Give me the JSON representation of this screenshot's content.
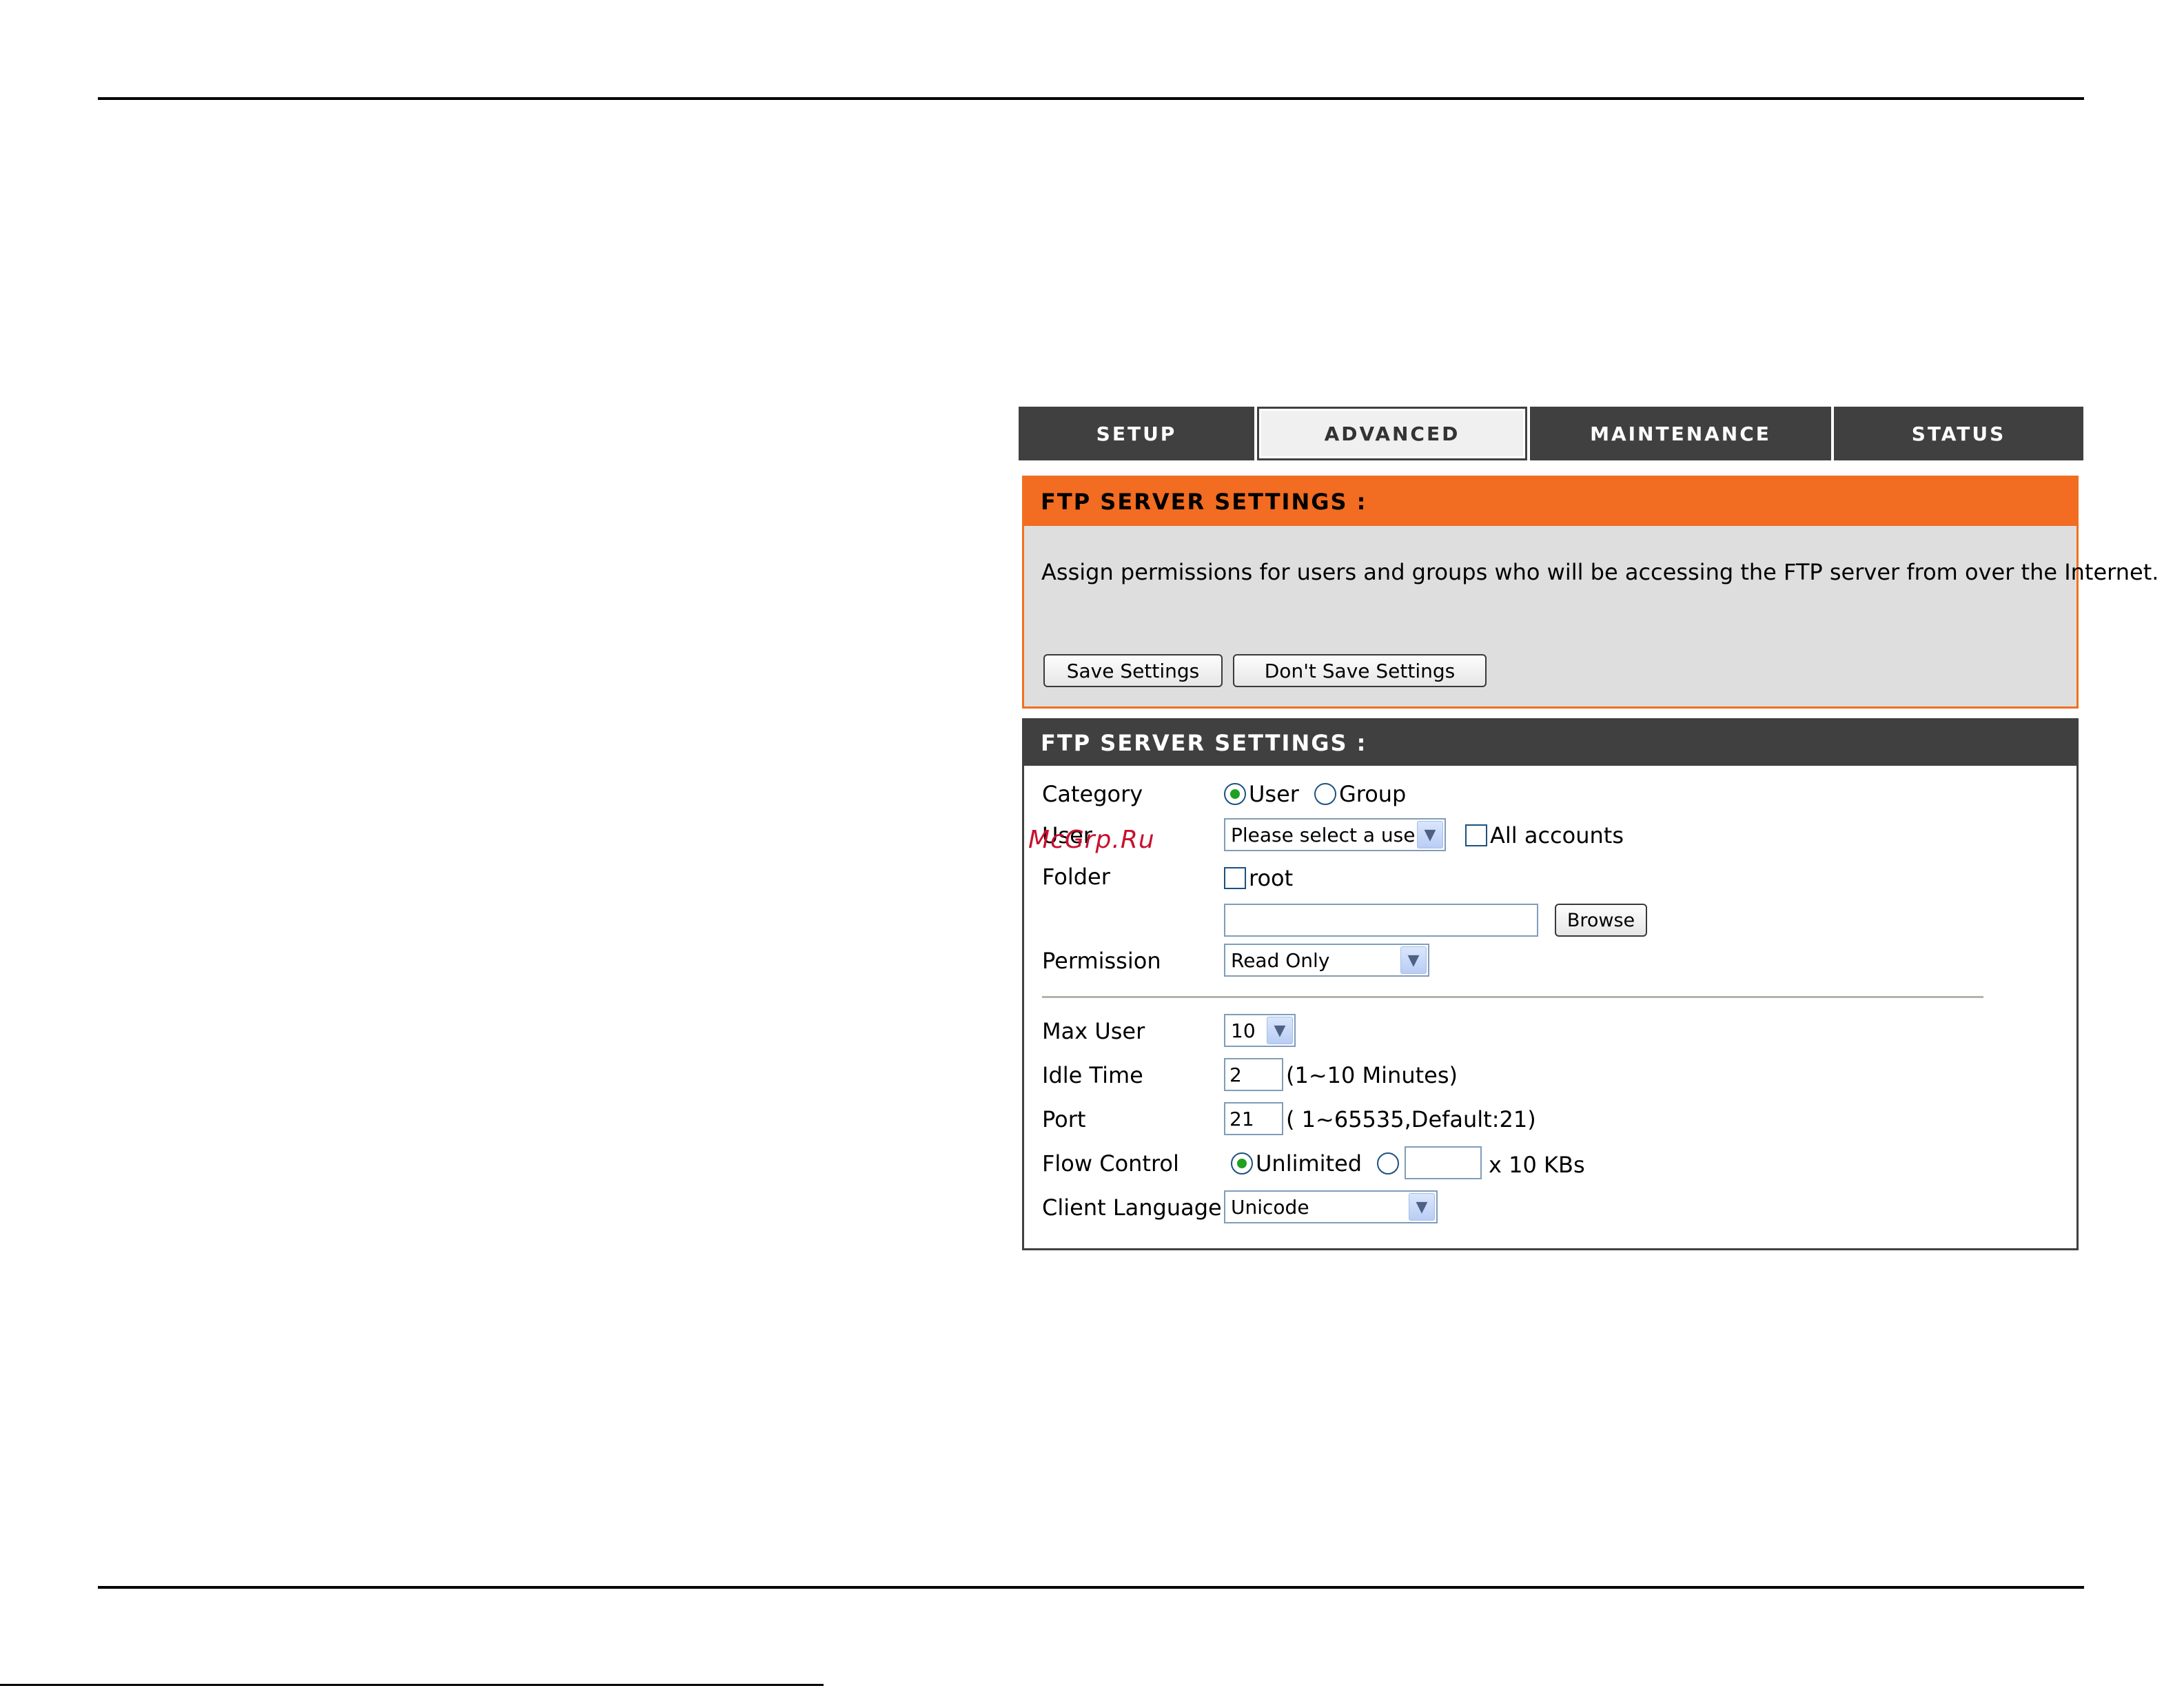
{
  "tabs": [
    {
      "label": "SETUP"
    },
    {
      "label": "ADVANCED"
    },
    {
      "label": "MAINTENANCE"
    },
    {
      "label": "STATUS"
    }
  ],
  "panel_top": {
    "title": "FTP SERVER SETTINGS :",
    "description": "Assign permissions for users and groups who will be accessing the FTP server from over the Internet.",
    "save_label": "Save Settings",
    "dont_save_label": "Don't Save Settings"
  },
  "panel_form": {
    "title": "FTP SERVER SETTINGS :",
    "category": {
      "label": "Category",
      "option_user": "User",
      "option_group": "Group"
    },
    "user": {
      "label": "User",
      "select_value": "Please select a user",
      "all_accounts": "All accounts"
    },
    "folder": {
      "label": "Folder",
      "root": "root",
      "path_value": "",
      "browse_label": "Browse"
    },
    "permission": {
      "label": "Permission",
      "value": "Read Only"
    },
    "max_user": {
      "label": "Max User",
      "value": "10"
    },
    "idle_time": {
      "label": "Idle Time",
      "value": "2",
      "hint": "(1~10 Minutes)"
    },
    "port": {
      "label": "Port",
      "value": "21",
      "hint": "( 1~65535,Default:21)"
    },
    "flow_control": {
      "label": "Flow Control",
      "unlimited": "Unlimited",
      "rate_value": "",
      "unit": "x 10 KBs"
    },
    "client_language": {
      "label": "Client Language",
      "value": "Unicode"
    }
  },
  "watermark": "McGrp.Ru",
  "colors": {
    "accent_orange": "#f26c22",
    "dark_header": "#404040",
    "panel_bg": "#dedede"
  }
}
